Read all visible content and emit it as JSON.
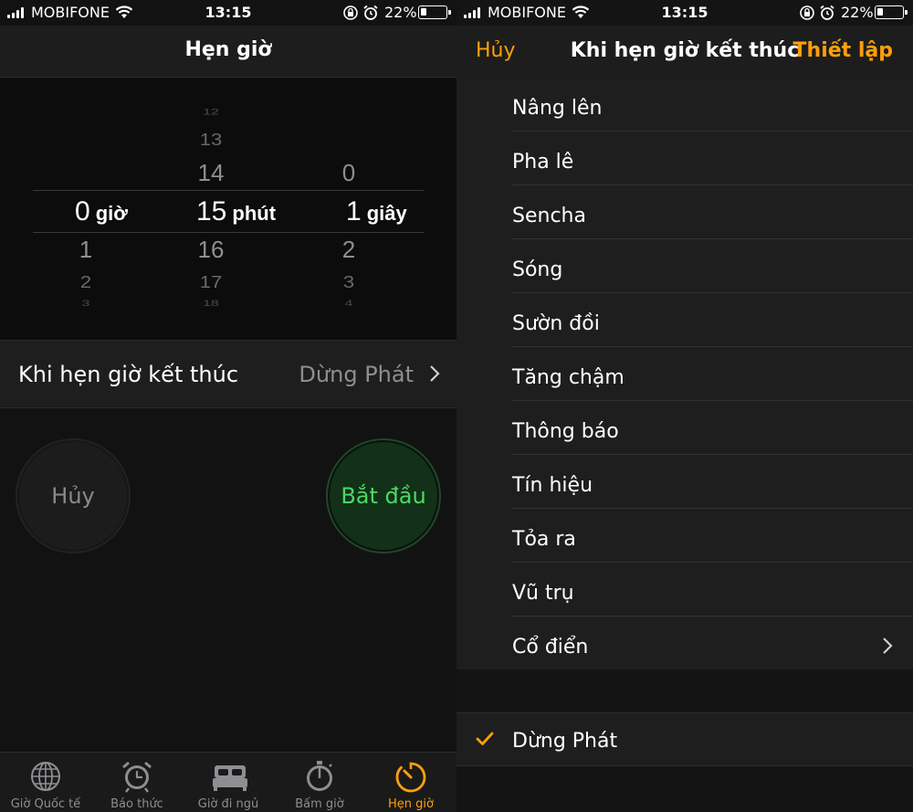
{
  "status": {
    "carrier": "MOBIFONE",
    "time": "13:15",
    "battery_percent": "22%",
    "battery_level": 0.22
  },
  "left": {
    "nav_title": "Hẹn giờ",
    "picker": {
      "hours": {
        "above": [],
        "selected": "0",
        "unit": "giờ",
        "below": [
          "1",
          "2",
          "3"
        ]
      },
      "minutes": {
        "above": [
          "12",
          "13",
          "14"
        ],
        "selected": "15",
        "unit": "phút",
        "below": [
          "16",
          "17",
          "18"
        ]
      },
      "seconds": {
        "above": [
          "0"
        ],
        "selected": "1",
        "unit": "giây",
        "below": [
          "2",
          "3",
          "4"
        ]
      }
    },
    "ends_row": {
      "label": "Khi hẹn giờ kết thúc",
      "value": "Dừng Phát"
    },
    "cancel_label": "Hủy",
    "start_label": "Bắt đầu",
    "tabs": [
      {
        "label": "Giờ Quốc tế",
        "icon": "globe-icon"
      },
      {
        "label": "Báo thức",
        "icon": "alarm-clock-icon"
      },
      {
        "label": "Giờ đi ngủ",
        "icon": "bed-icon"
      },
      {
        "label": "Bấm giờ",
        "icon": "stopwatch-icon"
      },
      {
        "label": "Hẹn giờ",
        "icon": "timer-icon",
        "active": true
      }
    ]
  },
  "right": {
    "cancel_label": "Hủy",
    "title": "Khi hẹn giờ kết thúc",
    "set_label": "Thiết lập",
    "sounds": [
      "Nâng lên",
      "Pha lê",
      "Sencha",
      "Sóng",
      "Sườn đồi",
      "Tăng chậm",
      "Thông báo",
      "Tín hiệu",
      "Tỏa ra",
      "Vũ trụ",
      "Cổ điển"
    ],
    "stop_label": "Dừng Phát"
  },
  "colors": {
    "accent": "#ff9f0a",
    "start_green": "#4cd964"
  }
}
